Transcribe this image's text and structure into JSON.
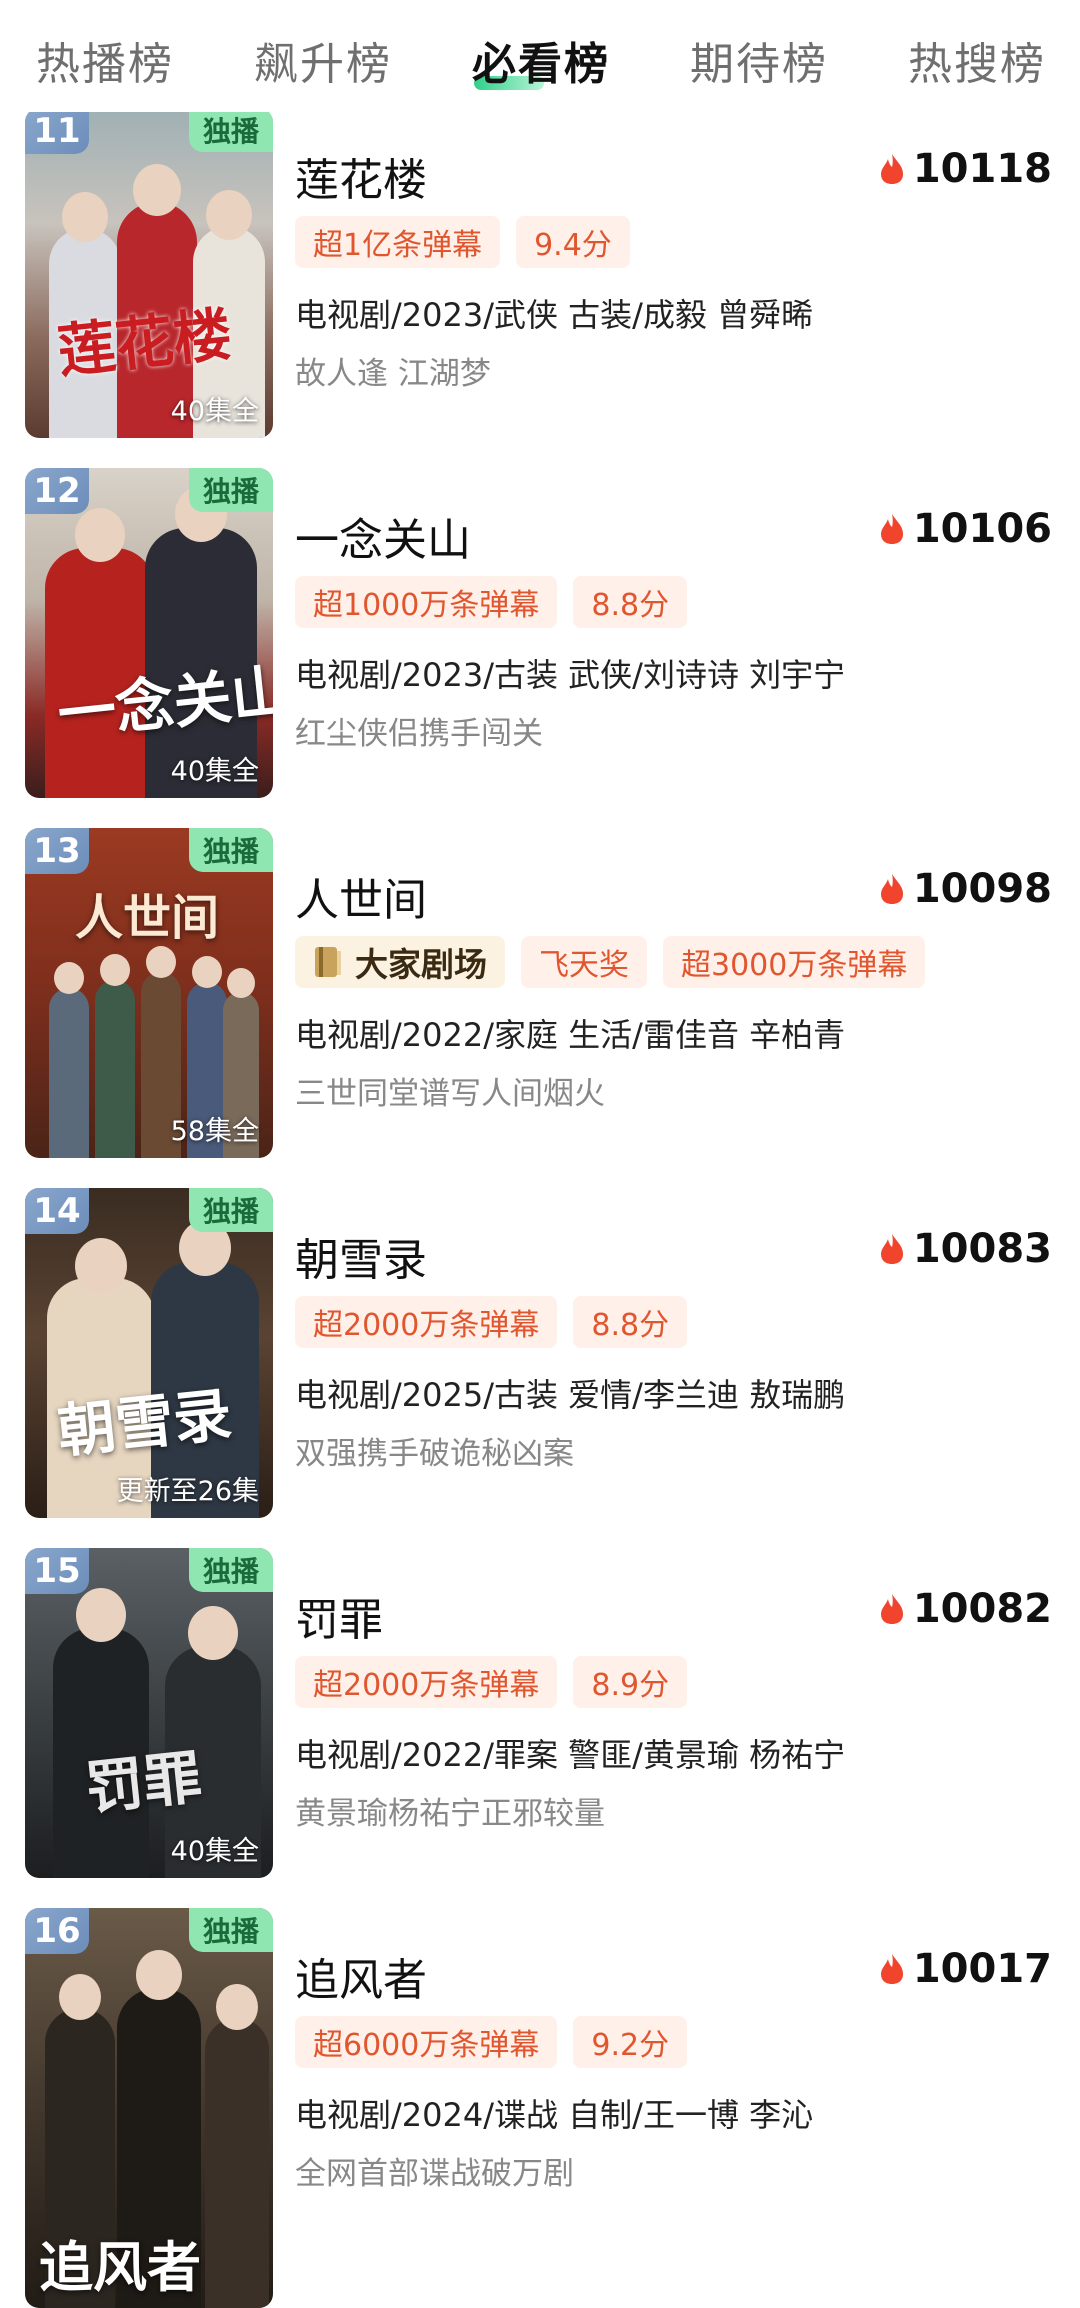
{
  "tabs": [
    {
      "label": "热播榜"
    },
    {
      "label": "飙升榜"
    },
    {
      "label": "必看榜",
      "active": true
    },
    {
      "label": "期待榜"
    },
    {
      "label": "热搜榜"
    }
  ],
  "accent_color": "#2fd18a",
  "tag_color": "#e0572f",
  "items": [
    {
      "rank": "11",
      "badge": "独播",
      "poster_title": "莲花楼",
      "episodes": "40集全",
      "title": "莲花楼",
      "heat": "10118",
      "tags": [
        "超1亿条弹幕",
        "9.4分"
      ],
      "meta": "电视剧/2023/武侠 古装/成毅 曾舜晞",
      "desc": "故人逢 江湖梦"
    },
    {
      "rank": "12",
      "badge": "独播",
      "poster_title": "一念关山",
      "episodes": "40集全",
      "title": "一念关山",
      "heat": "10106",
      "tags": [
        "超1000万条弹幕",
        "8.8分"
      ],
      "meta": "电视剧/2023/古装 武侠/刘诗诗 刘宇宁",
      "desc": "红尘侠侣携手闯关"
    },
    {
      "rank": "13",
      "badge": "独播",
      "poster_title": "人世间",
      "episodes": "58集全",
      "title": "人世间",
      "heat": "10098",
      "brand_tag": "大家剧场",
      "tags": [
        "飞天奖",
        "超3000万条弹幕"
      ],
      "meta": "电视剧/2022/家庭 生活/雷佳音 辛柏青",
      "desc": "三世同堂谱写人间烟火"
    },
    {
      "rank": "14",
      "badge": "独播",
      "poster_title": "朝雪录",
      "episodes": "更新至26集",
      "title": "朝雪录",
      "heat": "10083",
      "tags": [
        "超2000万条弹幕",
        "8.8分"
      ],
      "meta": "电视剧/2025/古装 爱情/李兰迪 敖瑞鹏",
      "desc": "双强携手破诡秘凶案"
    },
    {
      "rank": "15",
      "badge": "独播",
      "poster_title": "罚罪",
      "episodes": "40集全",
      "title": "罚罪",
      "heat": "10082",
      "tags": [
        "超2000万条弹幕",
        "8.9分"
      ],
      "meta": "电视剧/2022/罪案 警匪/黄景瑜 杨祐宁",
      "desc": "黄景瑜杨祐宁正邪较量"
    },
    {
      "rank": "16",
      "badge": "独播",
      "poster_title": "追风者",
      "episodes": "",
      "title": "追风者",
      "heat": "10017",
      "tags": [
        "超6000万条弹幕",
        "9.2分"
      ],
      "meta": "电视剧/2024/谍战 自制/王一博 李沁",
      "desc": "全网首部谍战破万剧"
    }
  ]
}
